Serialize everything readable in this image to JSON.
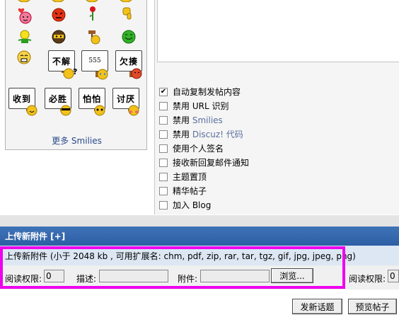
{
  "smilies": {
    "signs": [
      "不解",
      "555",
      "欠揍",
      "收到",
      "必胜",
      "怕怕",
      "讨厌"
    ],
    "more_label": "更多 Smilies"
  },
  "options": [
    {
      "label": "自动复制发帖内容",
      "checked": true
    },
    {
      "prefix": "禁用",
      "label": "URL 识别",
      "checked": false,
      "linked": false
    },
    {
      "prefix": "禁用",
      "label": "Smilies",
      "checked": false,
      "linked": true
    },
    {
      "prefix": "禁用",
      "label": "Discuz! 代码",
      "checked": false,
      "linked": true
    },
    {
      "label": "使用个人签名",
      "checked": false
    },
    {
      "label": "接收新回复邮件通知",
      "checked": false
    },
    {
      "label": "主题置顶",
      "checked": false
    },
    {
      "label": "精华帖子",
      "checked": false
    },
    {
      "label": "加入 Blog",
      "checked": false
    }
  ],
  "upload": {
    "header": "上传新附件 [+]",
    "info": "上传新附件 (小于 2048 kb , 可用扩展名: chm, pdf, zip, rar, tar, tgz, gif, jpg, jpeg, png)",
    "read_perm_label": "阅读权限:",
    "read_perm_value": "0",
    "desc_label": "描述:",
    "attach_label": "附件:",
    "browse_label": "浏览...",
    "read_perm_label_2": "阅读权限:",
    "read_perm_value_2": "0"
  },
  "buttons": {
    "new_topic": "发新话题",
    "preview": "预览帖子"
  },
  "colors": {
    "header_blue": "#2c5ea3",
    "info_bg": "#dde7f3",
    "highlight": "#ee00ee",
    "link": "#5a6f9c"
  }
}
